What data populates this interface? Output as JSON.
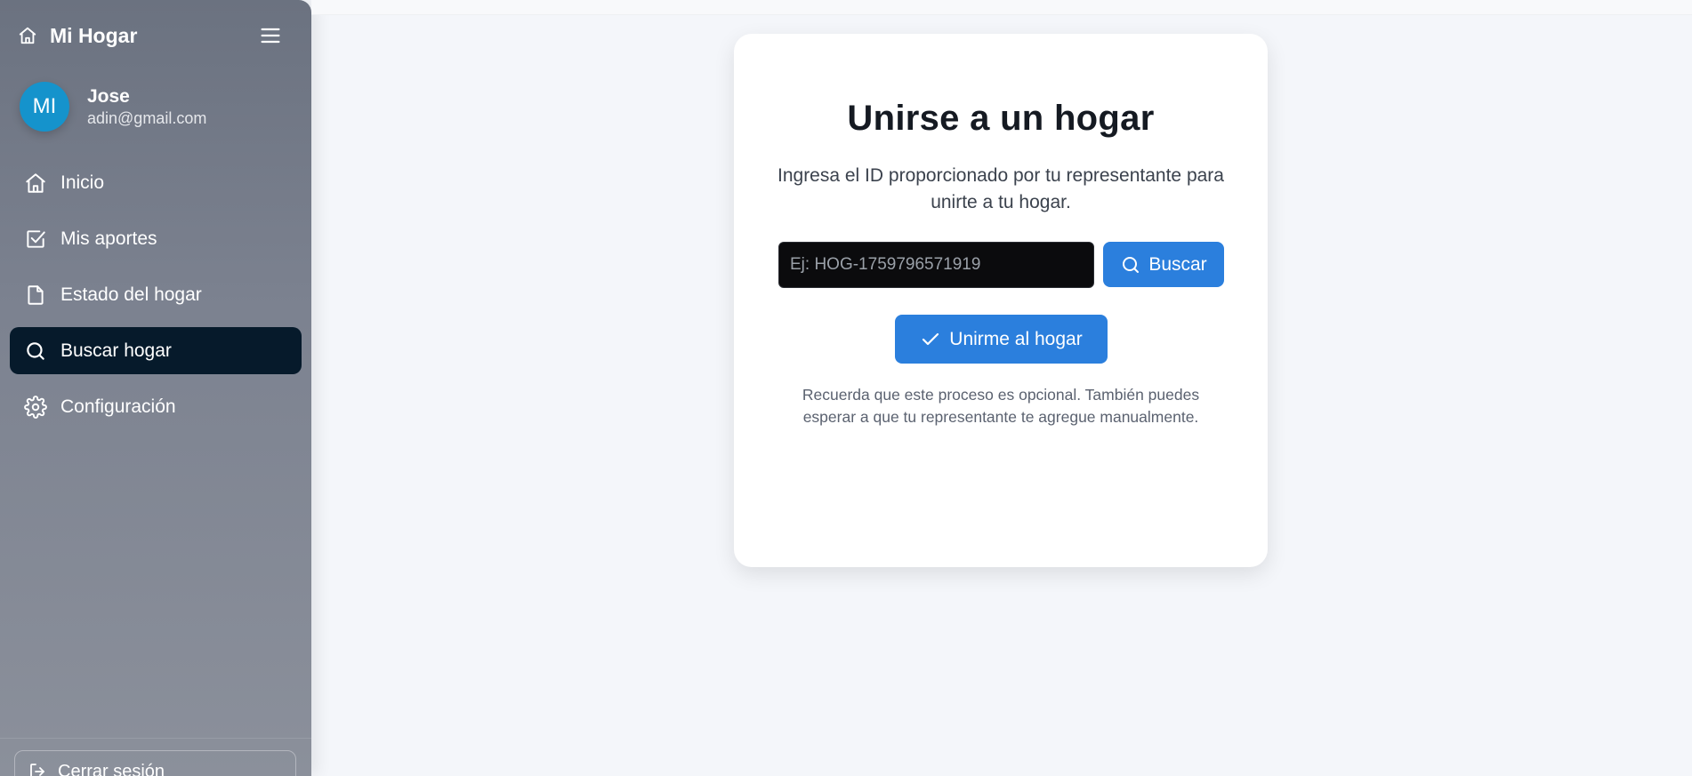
{
  "app": {
    "title": "Mi Hogar"
  },
  "user": {
    "initials": "MI",
    "name": "Jose",
    "email": "adin@gmail.com"
  },
  "nav": {
    "items": [
      {
        "label": "Inicio",
        "icon": "home-icon"
      },
      {
        "label": "Mis aportes",
        "icon": "checkbox-icon"
      },
      {
        "label": "Estado del hogar",
        "icon": "file-icon"
      },
      {
        "label": "Buscar hogar",
        "icon": "search-icon",
        "active": true
      },
      {
        "label": "Configuración",
        "icon": "gear-icon"
      }
    ]
  },
  "logout": {
    "label": "Cerrar sesión"
  },
  "card": {
    "title": "Unirse a un hogar",
    "description": "Ingresa el ID proporcionado por tu representante para unirte a tu hogar.",
    "input_value": "",
    "input_placeholder": "Ej: HOG-1759796571919",
    "search_label": "Buscar",
    "join_label": "Unirme al hogar",
    "note": "Recuerda que este proceso es opcional. También puedes esperar a que tu representante te agregue manualmente."
  },
  "colors": {
    "accent": "#2b7fdd",
    "active_nav": "#061a2b",
    "avatar": "#1593cc"
  }
}
